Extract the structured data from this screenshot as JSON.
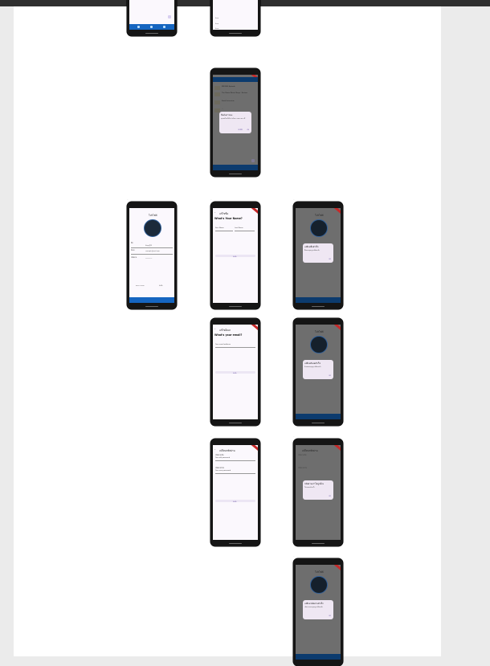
{
  "canvas": {
    "label": ""
  },
  "frame_labels": {
    "f_name": "...",
    "f_email": "...",
    "f_pw": "..."
  },
  "p_top1": {
    "nav_labels": [
      "",
      "",
      ""
    ]
  },
  "p_top2": {
    "items": [
      "Item",
      "Item",
      "Item"
    ]
  },
  "p_list": {
    "rows": [
      "MEI ENS Episode",
      "The Share Movie Sleep · Review",
      "Email Interview",
      "..."
    ],
    "dialog": {
      "title": "ยืนยันการลบ",
      "body": "คุณแน่ใจหรือไม่ว่าต้องการลบรายการนี้",
      "cancel": "ยกเลิก",
      "ok": "ลบ"
    }
  },
  "p_profile": {
    "title": "โปรไฟล์",
    "fields": [
      "ชื่อ",
      "อีเมล",
      "รหัสผ่าน"
    ],
    "values": [
      "ข้อมูลผู้ใช้",
      "example@mail.com",
      "••••••••"
    ],
    "buttons": [
      "ออกจากระบบ",
      "บันทึก"
    ]
  },
  "p_name": {
    "appbar": "แก้ไขชื่อ",
    "heading": "What's Your Name?",
    "first": "First Name",
    "last": "Last Name",
    "save": "บันทึก"
  },
  "p_email": {
    "appbar": "แก้ไขอีเมล",
    "heading": "What's your email?",
    "label": "Your email address",
    "save": "บันทึก"
  },
  "p_pw": {
    "appbar": "เปลี่ยนรหัสผ่าน",
    "label1": "รหัสผ่านเดิม",
    "ph1": "Your old password",
    "label2": "รหัสผ่านใหม่",
    "ph2": "Your new password",
    "save": "บันทึก"
  },
  "d_name": {
    "title": "เปลี่ยนชื่อสำเร็จ",
    "body": "ชื่อของคุณถูกเปลี่ยนแล้ว",
    "ok": "OK"
  },
  "d_email": {
    "title": "เปลี่ยนอีเมลสำเร็จ",
    "body": "อีเมลของคุณถูกเปลี่ยนแล้ว",
    "ok": "OK"
  },
  "d_pw": {
    "title": "รหัสผ่านเก่าไม่ถูกต้อง",
    "body": "โปรดลองอีกครั้ง",
    "ok": "OK"
  },
  "d_pw2": {
    "title": "เปลี่ยนรหัสผ่านสำเร็จ",
    "body": "รหัสผ่านของคุณถูกเปลี่ยนแล้ว",
    "ok": "OK"
  },
  "colors": {
    "canvas": "#ffffff",
    "background": "#ebebeb",
    "nav": "#1565c0",
    "ribbon": "#c62828"
  }
}
